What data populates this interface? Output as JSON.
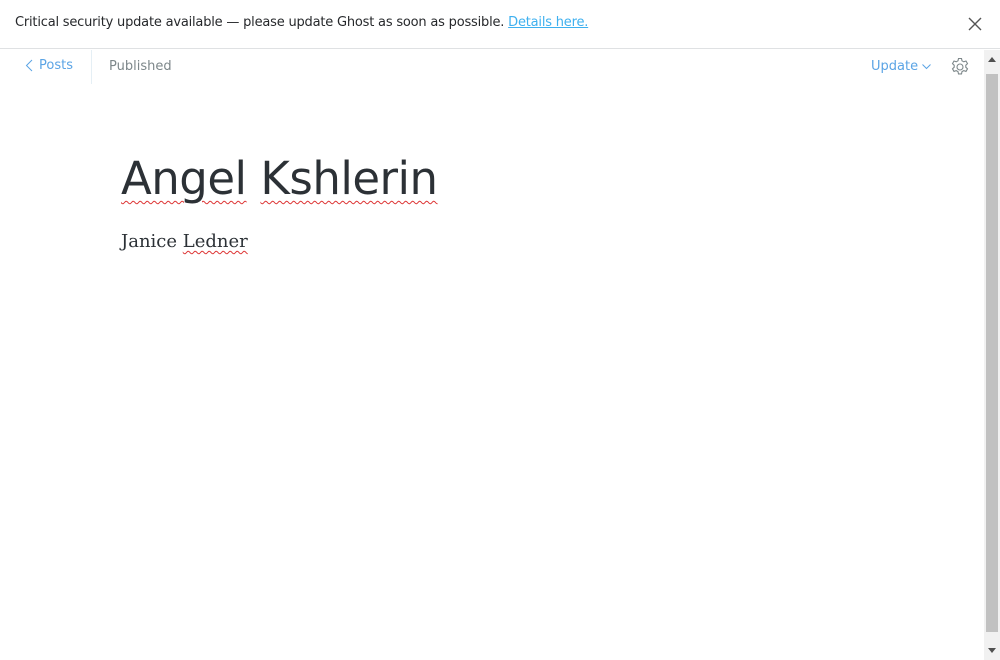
{
  "banner": {
    "message": "Critical security update available — please update Ghost as soon as possible. ",
    "link": "Details here."
  },
  "nav": {
    "back_label": "Posts",
    "status": "Published",
    "update_label": "Update"
  },
  "post": {
    "title_words": [
      "Angel",
      "Kshlerin"
    ],
    "body_words": [
      "Janice",
      "Ledner"
    ]
  }
}
